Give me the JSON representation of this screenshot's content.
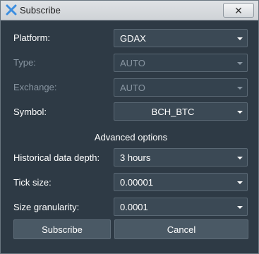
{
  "window": {
    "title": "Subscribe",
    "close_glyph": "✕"
  },
  "form": {
    "platform": {
      "label": "Platform:",
      "value": "GDAX"
    },
    "type": {
      "label": "Type:",
      "value": "AUTO"
    },
    "exchange": {
      "label": "Exchange:",
      "value": "AUTO"
    },
    "symbol": {
      "label": "Symbol:",
      "value": "BCH_BTC"
    },
    "advanced_title": "Advanced options",
    "history": {
      "label": "Historical data depth:",
      "value": "3 hours"
    },
    "tick": {
      "label": "Tick size:",
      "value": "0.00001"
    },
    "granularity": {
      "label": "Size granularity:",
      "value": "0.0001"
    }
  },
  "buttons": {
    "subscribe": "Subscribe",
    "cancel": "Cancel"
  },
  "colors": {
    "background": "#2e3a45",
    "field": "#3b4955",
    "button": "#4a5965",
    "disabled_text": "#8895a1",
    "icon_blue": "#3c8ee0"
  },
  "icons": {
    "app": "app-x-logo-icon",
    "close": "close-icon",
    "dropdown": "chevron-down-icon"
  }
}
